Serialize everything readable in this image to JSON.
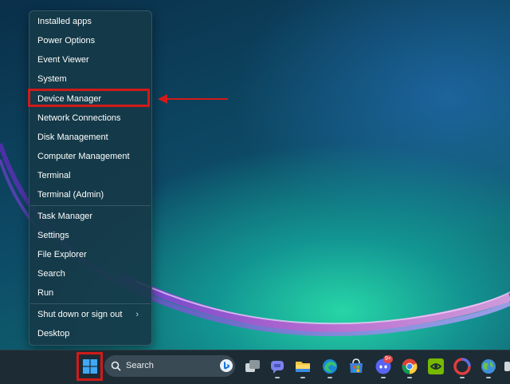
{
  "menu": {
    "items": [
      {
        "label": "Installed apps"
      },
      {
        "label": "Power Options"
      },
      {
        "label": "Event Viewer"
      },
      {
        "label": "System"
      },
      {
        "label": "Device Manager",
        "highlighted": true
      },
      {
        "label": "Network Connections"
      },
      {
        "label": "Disk Management"
      },
      {
        "label": "Computer Management"
      },
      {
        "label": "Terminal"
      },
      {
        "label": "Terminal (Admin)"
      },
      {
        "label": "Task Manager"
      },
      {
        "label": "Settings"
      },
      {
        "label": "File Explorer"
      },
      {
        "label": "Search"
      },
      {
        "label": "Run"
      },
      {
        "label": "Shut down or sign out",
        "has_submenu": true
      },
      {
        "label": "Desktop"
      }
    ],
    "submenu_glyph": "›"
  },
  "taskbar": {
    "search_label": "Search",
    "notification_badge": "9+",
    "icons": [
      "start-icon",
      "search-icon",
      "bing-icon",
      "task-view-icon",
      "teams-chat-icon",
      "file-explorer-icon",
      "edge-icon",
      "microsoft-store-icon",
      "discord-icon",
      "chrome-icon",
      "nvidia-icon",
      "opera-icon",
      "browser-globe-icon"
    ]
  },
  "annotation": {
    "color": "#d11a1a"
  },
  "colors": {
    "menu_bg": "#163a48",
    "taskbar_bg": "#1d2b34",
    "highlight": "#d11a1a"
  }
}
